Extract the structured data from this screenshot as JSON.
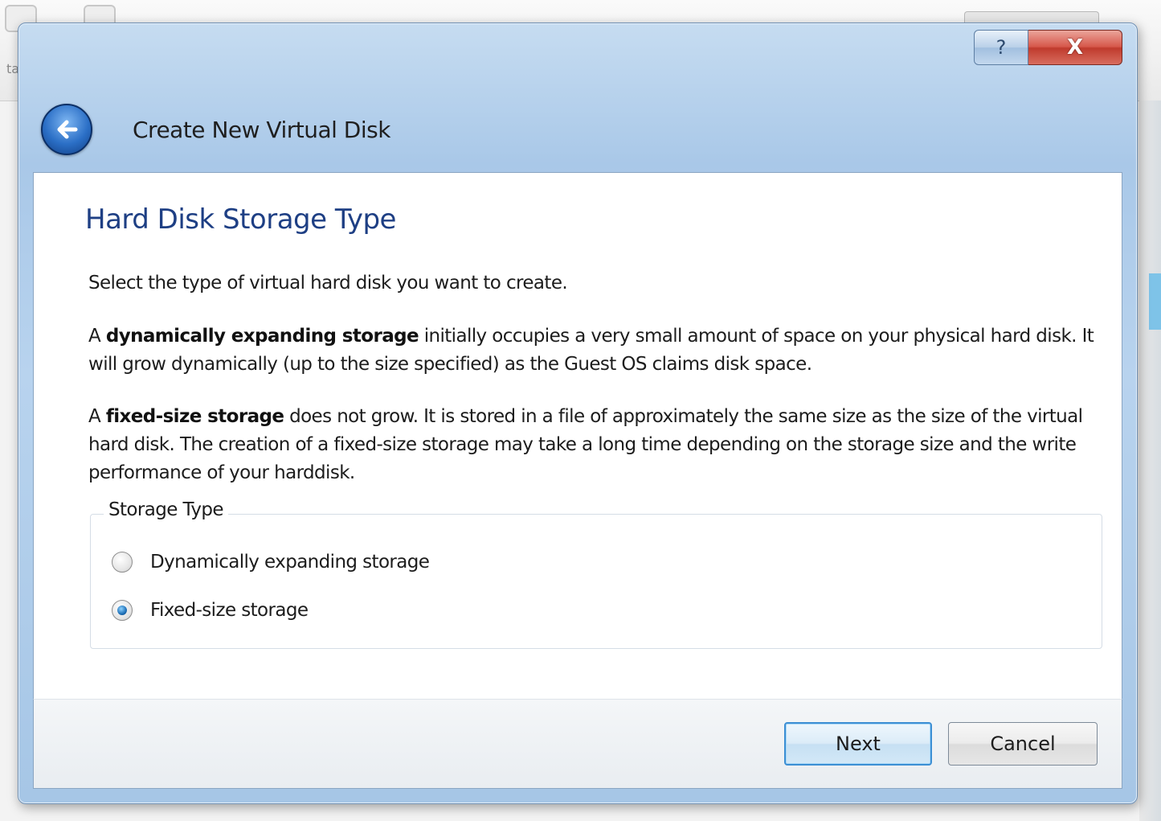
{
  "background": {
    "tab_text": "ta"
  },
  "titlebar": {
    "help_label": "?",
    "close_label": "X"
  },
  "dialog": {
    "title": "Create New Virtual Disk",
    "back_icon": "back-arrow-icon"
  },
  "page": {
    "heading": "Hard Disk Storage Type",
    "intro": "Select the type of virtual hard disk you want to create.",
    "dynamic_desc": {
      "prefix": "A ",
      "bold": "dynamically expanding storage",
      "rest": " initially occupies a very small amount of space on your physical hard disk. It will grow dynamically (up to the size specified) as the Guest OS claims disk space."
    },
    "fixed_desc": {
      "prefix": "A ",
      "bold": "fixed-size storage",
      "rest": " does not grow. It is stored in a file of approximately the same size as the size of the virtual hard disk. The creation of a fixed-size storage may take a long time depending on the storage size and the write performance of your harddisk."
    }
  },
  "storage_type": {
    "legend": "Storage Type",
    "options": [
      {
        "label": "Dynamically expanding storage",
        "selected": false
      },
      {
        "label": "Fixed-size storage",
        "selected": true
      }
    ]
  },
  "footer": {
    "next_label": "Next",
    "cancel_label": "Cancel"
  },
  "colors": {
    "heading": "#1e3f84",
    "close_button": "#d6574a",
    "default_button_border": "#3c8fd4"
  }
}
